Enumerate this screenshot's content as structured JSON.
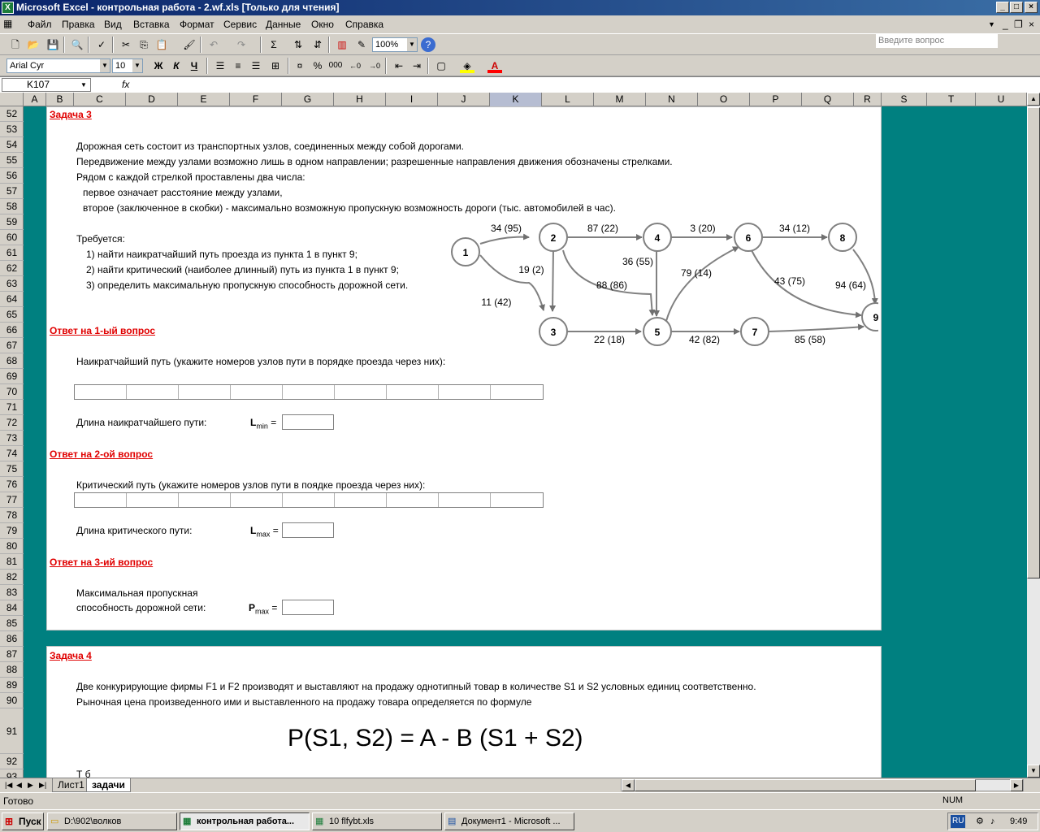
{
  "window": {
    "title": "Microsoft Excel - контрольная работа - 2.wf.xls  [Только для чтения]"
  },
  "menu": {
    "items": [
      "Файл",
      "Правка",
      "Вид",
      "Вставка",
      "Формат",
      "Сервис",
      "Данные",
      "Окно",
      "Справка"
    ],
    "ask_placeholder": "Введите вопрос"
  },
  "toolbar": {
    "zoom": "100%",
    "font": "Arial Cyr",
    "size": "10",
    "bold": "Ж",
    "italic": "К",
    "underline": "Ч",
    "percent": "%",
    "thousands": "000",
    "sigma": "Σ"
  },
  "formula": {
    "cell_ref": "K107",
    "fx": "fx",
    "value": ""
  },
  "columns": [
    "A",
    "B",
    "C",
    "D",
    "E",
    "F",
    "G",
    "H",
    "I",
    "J",
    "K",
    "L",
    "M",
    "N",
    "O",
    "P",
    "Q",
    "R",
    "S",
    "T",
    "U"
  ],
  "rows": [
    "52",
    "53",
    "54",
    "55",
    "56",
    "57",
    "58",
    "59",
    "60",
    "61",
    "62",
    "63",
    "64",
    "65",
    "66",
    "67",
    "68",
    "69",
    "70",
    "71",
    "72",
    "73",
    "74",
    "75",
    "76",
    "77",
    "78",
    "79",
    "80",
    "81",
    "82",
    "83",
    "84",
    "85",
    "86",
    "87",
    "88",
    "89",
    "90",
    "91",
    "92",
    "93"
  ],
  "task3": {
    "heading": "Задача 3",
    "lines": [
      "Дорожная сеть состоит из транспортных узлов, соединенных между собой дорогами.",
      "Передвижение между узлами возможно лишь в одном направлении; разрешенные направления движения обозначены стрелками.",
      "Рядом с каждой стрелкой проставлены два числа:",
      "первое означает расстояние между узлами,",
      "второе (заключенное в скобки) - максимально возможную пропускную возможность дороги  (тыс. автомобилей в час)."
    ],
    "req_title": "Требуется:",
    "reqs": [
      "1) найти наикратчайший путь проезда из пункта 1 в пункт 9;",
      "2) найти критический (наиболее длинный) путь из пункта 1 в пункт 9;",
      "3) определить максимальную пропускную способность дорожной сети."
    ],
    "answer1": "Ответ на 1-ый вопрос",
    "shortest_prompt": "Наикратчайший путь (укажите номеров узлов пути в порядке проезда через них):",
    "shortest_len": "Длина наикратчайшего пути:",
    "lmin": "L",
    "lmin_sub": "min",
    "eq": "=",
    "answer2": "Ответ на 2-ой вопрос",
    "critical_prompt": "Критический путь (укажите номеров узлов пути в поядке проезда через них):",
    "critical_len": "Длина критического пути:",
    "lmax": "L",
    "lmax_sub": "max",
    "answer3": "Ответ на 3-ий вопрос",
    "capacity1": "Максимальная пропускная",
    "capacity2": "способность дорожной сети:",
    "pmax": "P",
    "pmax_sub": "max"
  },
  "graph": {
    "nodes": [
      {
        "id": "1"
      },
      {
        "id": "2"
      },
      {
        "id": "3"
      },
      {
        "id": "4"
      },
      {
        "id": "5"
      },
      {
        "id": "6"
      },
      {
        "id": "7"
      },
      {
        "id": "8"
      },
      {
        "id": "9"
      }
    ],
    "edges": [
      {
        "from": "1",
        "to": "2",
        "label": "34 (95)"
      },
      {
        "from": "1",
        "to": "3",
        "label": "11 (42)"
      },
      {
        "from": "2",
        "to": "3",
        "label": "19 (2)"
      },
      {
        "from": "2",
        "to": "4",
        "label": "87 (22)"
      },
      {
        "from": "2",
        "to": "5",
        "label": "88 (86)"
      },
      {
        "from": "3",
        "to": "5",
        "label": "22 (18)"
      },
      {
        "from": "4",
        "to": "5",
        "label": "36 (55)"
      },
      {
        "from": "4",
        "to": "6",
        "label": "3 (20)"
      },
      {
        "from": "5",
        "to": "6",
        "label": "79 (14)"
      },
      {
        "from": "5",
        "to": "7",
        "label": "42 (82)"
      },
      {
        "from": "6",
        "to": "8",
        "label": "34 (12)"
      },
      {
        "from": "6",
        "to": "9",
        "label": "43 (75)"
      },
      {
        "from": "7",
        "to": "9",
        "label": "85 (58)"
      },
      {
        "from": "8",
        "to": "9",
        "label": "94 (64)"
      }
    ]
  },
  "task4": {
    "heading": "Задача 4",
    "line1": "Две конкурирующие фирмы F1 и F2 производят и выставляют на продажу однотипный товар в количестве S1 и  S2 условных единиц соответственно.",
    "line2": "Рыночная цена произведенного ими и выставленного на продажу товара определяется по формуле",
    "formula": "P(S1, S2) = A - B (S1 + S2)",
    "cut": "Т   б"
  },
  "sheets": [
    "Лист1",
    "задачи"
  ],
  "status": {
    "left": "Готово",
    "num": "NUM"
  },
  "taskbar": {
    "start": "Пуск",
    "items": [
      "D:\\902\\волков",
      "контрольная работа...",
      "10 flfybt.xls",
      "Документ1 - Microsoft ..."
    ],
    "lang": "RU",
    "time": "9:49"
  }
}
